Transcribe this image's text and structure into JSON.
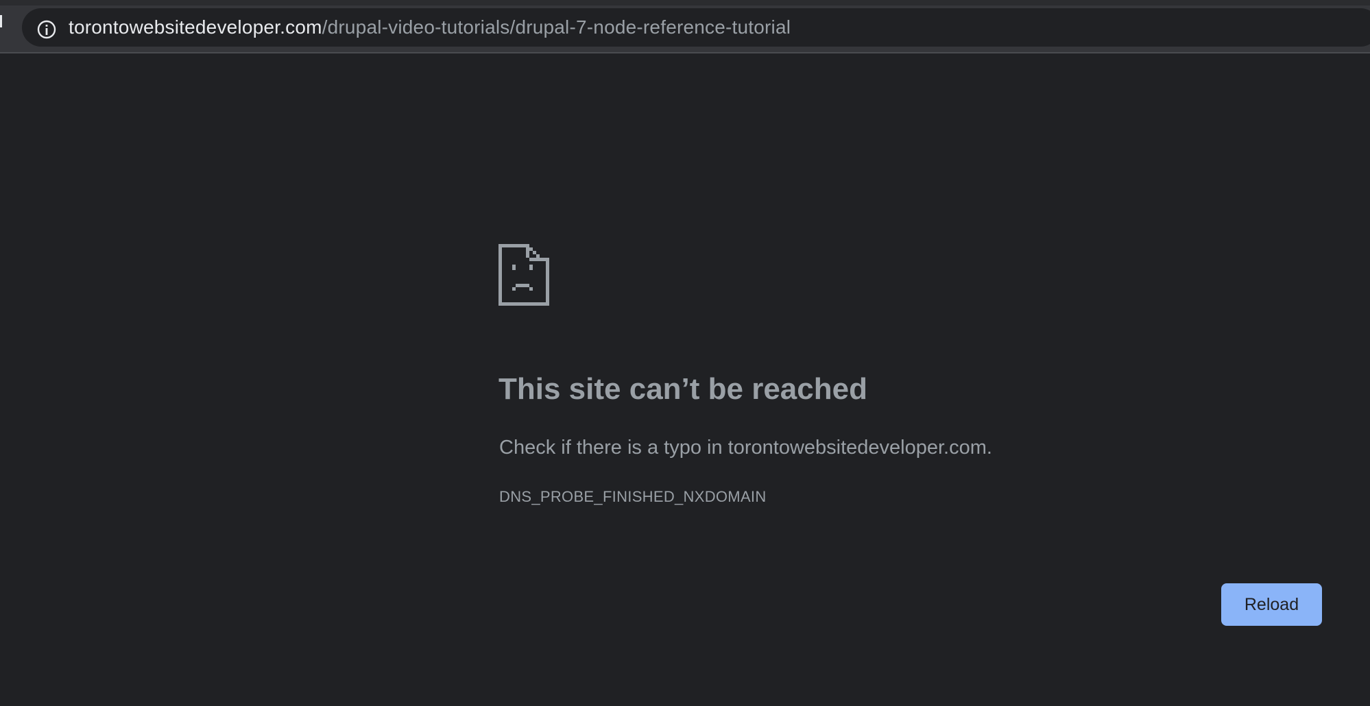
{
  "omnibox": {
    "icon": "info-icon",
    "url_host": "torontowebsitedeveloper.com",
    "url_path": "/drupal-video-tutorials/drupal-7-node-reference-tutorial"
  },
  "error_page": {
    "icon": "sad-document-icon",
    "headline": "This site can’t be reached",
    "suggestion": "Check if there is a typo in torontowebsitedeveloper.com.",
    "error_code": "DNS_PROBE_FINISHED_NXDOMAIN",
    "reload_label": "Reload"
  },
  "colors": {
    "background": "#202124",
    "text_muted": "#9aa0a6",
    "text_bright": "#e8eaed",
    "accent": "#8ab4f8"
  }
}
